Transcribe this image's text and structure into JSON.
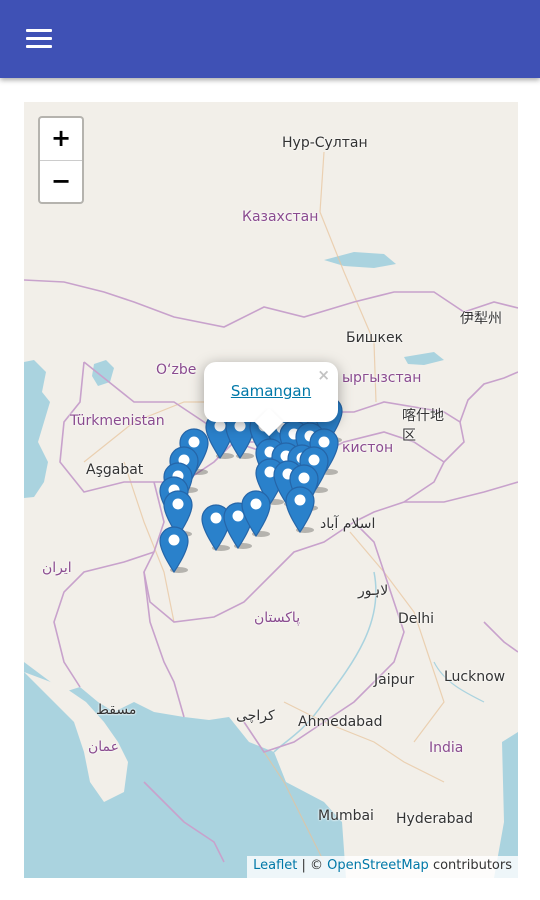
{
  "appbar": {
    "color": "#3f51b5",
    "menu_icon": "hamburger-menu-icon"
  },
  "map": {
    "zoom_in": "+",
    "zoom_out": "−",
    "popup": {
      "title": "Samangan",
      "close": "×"
    },
    "attribution": {
      "leaflet": "Leaflet",
      "separator": " | © ",
      "osm": "OpenStreetMap",
      "contributors": " contributors"
    },
    "labels": {
      "nur_sultan": "Нур-Султан",
      "kazakhstan": "Казахстан",
      "yining": "伊犁州",
      "bishkek": "Бишкек",
      "uzbekistan": "O‘zbe",
      "kyrgyzstan": "ыргызстан",
      "turkmenistan": "Türkmenistan",
      "kashgar": "喀什地\n区",
      "ashgabat": "Aşgabat",
      "tajikistan": "кистон",
      "islamabad": "اسلام آباد",
      "iran": "ایران",
      "lahore": "لاہور",
      "pakistan": "پاکستان",
      "delhi": "Delhi",
      "jaipur": "Jaipur",
      "lucknow": "Lucknow",
      "muscat": "مسقط",
      "karachi": "کراچی",
      "ahmedabad": "Ahmedabad",
      "oman": "عمان",
      "india": "India",
      "mumbai": "Mumbai",
      "hyderabad": "Hyderabad"
    },
    "marker_color": "#2a81cb",
    "marker_count": 32
  }
}
